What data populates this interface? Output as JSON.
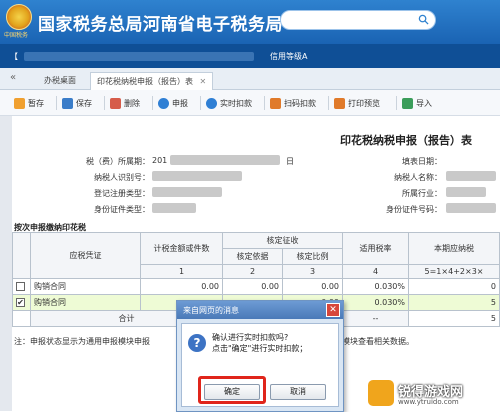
{
  "header": {
    "emblem_text": "中国税务",
    "site_title": "国家税务总局河南省电子税务局",
    "credit_label": "信用等级A"
  },
  "tabs": [
    {
      "label": "办税桌面"
    },
    {
      "label": "印花税纳税申报（报告）表",
      "close": "✕"
    }
  ],
  "toolbar": {
    "items": [
      "暂存",
      "保存",
      "删除",
      "申报",
      "实时扣款",
      "扫码扣款",
      "打印预览",
      "导入"
    ]
  },
  "form": {
    "title": "印花税纳税申报（报告）表",
    "period_label": "税（费）所属期：",
    "period_value": "201",
    "period_suffix": "日",
    "taxpayer_id_label": "纳税人识别号：",
    "reg_type_label": "登记注册类型：",
    "id_type_label": "身份证件类型：",
    "fill_date_label": "填表日期：",
    "taxpayer_name_label": "纳税人名称：",
    "industry_label": "所属行业：",
    "id_number_label": "身份证件号码："
  },
  "section": {
    "title": "按次申报缴纳印花税"
  },
  "table": {
    "col_voucher": "应税凭证",
    "col_amount": "计税金额或件数",
    "col_approve_group": "核定征收",
    "col_basis": "核定依据",
    "col_ratio": "核定比例",
    "col_rate": "适用税率",
    "col_payable": "本期应纳税",
    "idx_1": "1",
    "idx_2": "2",
    "idx_3": "3",
    "idx_4": "4",
    "idx_5": "5=1×4+2×3×",
    "rows": [
      {
        "check": "",
        "name": "购销合同",
        "amount": "0.00",
        "basis": "0.00",
        "ratio": "0.00",
        "rate": "0.030%",
        "pay": "0"
      },
      {
        "check": "✔",
        "name": "购销合同",
        "amount": "",
        "basis": "",
        "ratio": "0.00",
        "rate": "0.030%",
        "pay": "5"
      }
    ],
    "total_label": "合计",
    "total_rate": "--",
    "total_pay": "5"
  },
  "note": {
    "text_left": "注：申报状态显示为通用申报模块申报",
    "text_right": "模块查看相关数据。"
  },
  "dialog": {
    "title": "来自网页的消息",
    "close": "✕",
    "line1": "确认进行实时扣款吗?",
    "line2": "点击\"确定\"进行实时扣款；",
    "ok": "确定",
    "cancel": "取消"
  },
  "watermark": {
    "name": "锐得游戏网",
    "url": "www.ytruido.com"
  },
  "colors": {
    "banner": "#1a63b3",
    "nav": "#0f4f96",
    "selected_row": "#eefbd5",
    "highlight": "#e0251b"
  }
}
